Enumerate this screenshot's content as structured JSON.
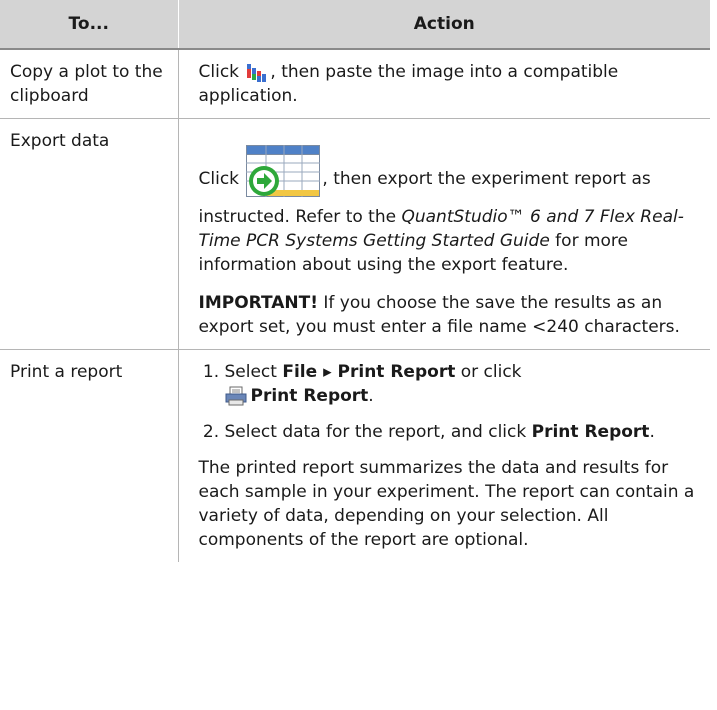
{
  "table": {
    "headers": [
      "To...",
      "Action"
    ],
    "row_copy": {
      "task": "Copy a plot to the clipboard",
      "action_before": "Click ",
      "action_after": ", then paste the image into a compatible application.",
      "icon": "copy-plot-icon"
    },
    "row_export": {
      "task": "Export data",
      "action_before": "Click ",
      "action_after_1": ", then export the experiment report as instructed. Refer to the ",
      "guide_title": "QuantStudio™ 6 and 7 Flex Real-Time PCR Systems Getting Started Guide",
      "action_after_2": " for more information about using the export feature.",
      "important_label": "IMPORTANT!",
      "important_text": " If you choose the save the results as an export set, you must enter a file name <240 characters.",
      "icon": "export-icon"
    },
    "row_print": {
      "task": "Print a report",
      "step1_before": "Select ",
      "step1_menu": "File ▸ Print Report",
      "step1_middle": " or click",
      "step1_button": "Print Report",
      "step1_end": ".",
      "step2_before": "Select data for the report, and click ",
      "step2_button": "Print Report",
      "step2_end": ".",
      "note": "The printed report summarizes the data and results for each sample in your experiment. The report can contain a variety of data, depending on your selection. All components of the report are optional.",
      "icon": "print-icon"
    }
  }
}
